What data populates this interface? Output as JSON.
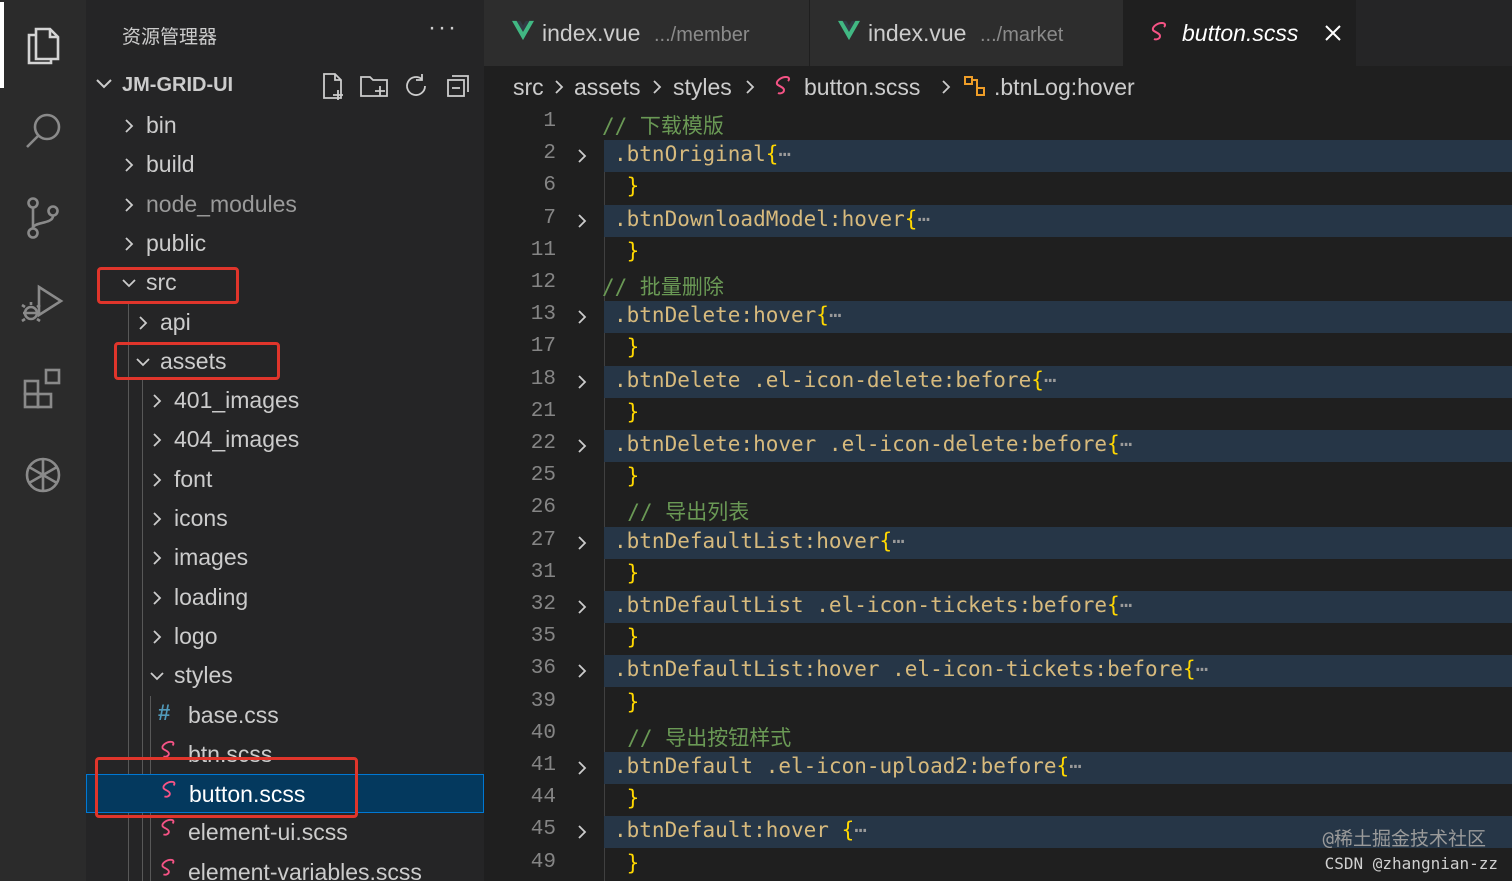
{
  "activity_bar": {
    "items": [
      "explorer-icon",
      "search-icon",
      "source-control-icon",
      "run-debug-icon",
      "extensions-icon",
      "chatgpt-icon"
    ]
  },
  "sidebar": {
    "title": "资源管理器",
    "more": "···",
    "project": "JM-GRID-UI",
    "tree": [
      {
        "label": "bin",
        "expanded": false
      },
      {
        "label": "build",
        "expanded": false
      },
      {
        "label": "node_modules",
        "expanded": false,
        "dim": true
      },
      {
        "label": "public",
        "expanded": false
      },
      {
        "label": "src",
        "expanded": true,
        "highlighted": true
      },
      {
        "label": "api",
        "expanded": false
      },
      {
        "label": "assets",
        "expanded": true,
        "highlighted": true
      },
      {
        "label": "401_images",
        "expanded": false
      },
      {
        "label": "404_images",
        "expanded": false
      },
      {
        "label": "font",
        "expanded": false
      },
      {
        "label": "icons",
        "expanded": false
      },
      {
        "label": "images",
        "expanded": false
      },
      {
        "label": "loading",
        "expanded": false
      },
      {
        "label": "logo",
        "expanded": false
      },
      {
        "label": "styles",
        "expanded": true
      },
      {
        "label": "base.css",
        "file": "css"
      },
      {
        "label": "btn.scss",
        "file": "scss"
      },
      {
        "label": "button.scss",
        "file": "scss",
        "selected": true,
        "highlighted": true
      },
      {
        "label": "element-ui.scss",
        "file": "scss"
      },
      {
        "label": "element-variables.scss",
        "file": "scss"
      }
    ]
  },
  "tabs": [
    {
      "name": "index.vue",
      "desc": ".../member",
      "icon": "vue-icon"
    },
    {
      "name": "index.vue",
      "desc": ".../market",
      "icon": "vue-icon"
    },
    {
      "name": "button.scss",
      "desc": "",
      "icon": "sass-icon",
      "active": true
    }
  ],
  "breadcrumb": {
    "items": [
      "src",
      "assets",
      "styles",
      "button.scss",
      ".btnLog:hover"
    ]
  },
  "editor": {
    "lines": [
      {
        "n": "1",
        "text": "// 下载模版",
        "kind": "comment"
      },
      {
        "n": "2",
        "text": ".btnOriginal",
        "kind": "folded",
        "tail": "{"
      },
      {
        "n": "6",
        "text": " }",
        "kind": "close"
      },
      {
        "n": "7",
        "text": ".btnDownloadModel:hover",
        "kind": "folded",
        "tail": "{"
      },
      {
        "n": "11",
        "text": " }",
        "kind": "close"
      },
      {
        "n": "12",
        "text": "// 批量删除",
        "kind": "comment"
      },
      {
        "n": "13",
        "text": ".btnDelete:hover",
        "kind": "folded",
        "tail": "{"
      },
      {
        "n": "17",
        "text": " }",
        "kind": "close"
      },
      {
        "n": "18",
        "text": ".btnDelete .el-icon-delete:before",
        "kind": "folded",
        "tail": "{"
      },
      {
        "n": "21",
        "text": " }",
        "kind": "close"
      },
      {
        "n": "22",
        "text": ".btnDelete:hover .el-icon-delete:before",
        "kind": "folded",
        "tail": "{"
      },
      {
        "n": "25",
        "text": " }",
        "kind": "close"
      },
      {
        "n": "26",
        "text": "  // 导出列表",
        "kind": "comment"
      },
      {
        "n": "27",
        "text": ".btnDefaultList:hover",
        "kind": "folded",
        "tail": "{"
      },
      {
        "n": "31",
        "text": " }",
        "kind": "close"
      },
      {
        "n": "32",
        "text": ".btnDefaultList .el-icon-tickets:before",
        "kind": "folded",
        "tail": "{"
      },
      {
        "n": "35",
        "text": " }",
        "kind": "close"
      },
      {
        "n": "36",
        "text": ".btnDefaultList:hover .el-icon-tickets:before",
        "kind": "folded",
        "tail": "{"
      },
      {
        "n": "39",
        "text": " }",
        "kind": "close"
      },
      {
        "n": "40",
        "text": "  // 导出按钮样式",
        "kind": "comment"
      },
      {
        "n": "41",
        "text": ".btnDefault .el-icon-upload2:before",
        "kind": "folded",
        "tail": "{"
      },
      {
        "n": "44",
        "text": " }",
        "kind": "close"
      },
      {
        "n": "45",
        "text": ".btnDefault:hover ",
        "kind": "folded",
        "tail": "{"
      },
      {
        "n": "49",
        "text": " }",
        "kind": "close"
      }
    ],
    "fold_marker": "⋯"
  },
  "watermark": {
    "line1": "@稀土掘金技术社区",
    "line2": "CSDN @zhangnian-zz"
  },
  "colors": {
    "accent": "#0078d4",
    "highlight_box": "#e0352b",
    "selector": "#d7ba7d",
    "comment": "#6a9955",
    "brace": "#ffd700",
    "vue_green": "#41b883",
    "sass_pink": "#f55385"
  }
}
